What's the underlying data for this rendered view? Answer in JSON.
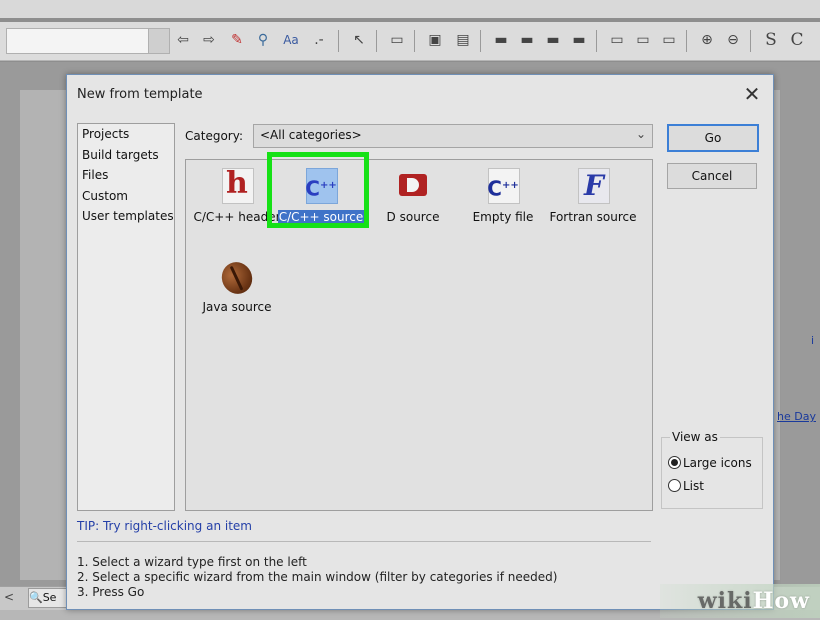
{
  "background": {
    "link_fragment_1": "i",
    "link_fragment_2": "he Day",
    "search_tab": "Se",
    "toolbar_icons": [
      "back-arrow-icon",
      "forward-arrow-icon",
      "highlight-icon",
      "find-icon",
      "replace-icon",
      "comment-icon",
      "select-icon",
      "box-icon",
      "image-icon",
      "table-icon",
      "bar-icon",
      "bar-icon",
      "bar-icon",
      "bar-icon",
      "rect-icon",
      "rect-icon",
      "rect-icon",
      "zoom-in-icon",
      "zoom-out-icon"
    ],
    "toolbar_letters": [
      "S",
      "C"
    ]
  },
  "dialog": {
    "title": "New from template",
    "close_glyph": "✕",
    "left_list": [
      "Projects",
      "Build targets",
      "Files",
      "Custom",
      "User templates"
    ],
    "category_label": "Category:",
    "category_value": "<All categories>",
    "templates": [
      {
        "label": "C/C++ header",
        "icon": "c-header-icon",
        "selected": false
      },
      {
        "label": "C/C++ source",
        "icon": "c-source-icon",
        "selected": true
      },
      {
        "label": "D source",
        "icon": "d-source-icon",
        "selected": false
      },
      {
        "label": "Empty file",
        "icon": "empty-file-icon",
        "selected": false
      },
      {
        "label": "Fortran source",
        "icon": "fortran-source-icon",
        "selected": false
      },
      {
        "label": "Java source",
        "icon": "java-source-icon",
        "selected": false
      }
    ],
    "go_label": "Go",
    "cancel_label": "Cancel",
    "view_as": {
      "legend": "View as",
      "options": [
        "Large icons",
        "List"
      ],
      "selected": "Large icons"
    },
    "tip": "TIP: Try right-clicking an item",
    "instructions": [
      "1. Select a wizard type first on the left",
      "2. Select a specific wizard from the main window (filter by categories if needed)",
      "3. Press Go"
    ]
  },
  "watermark": {
    "wiki": "wiki",
    "how": "How"
  },
  "colors": {
    "selection": "#3f73c8",
    "highlight_frame": "#16e116",
    "tip_text": "#2540a8"
  }
}
